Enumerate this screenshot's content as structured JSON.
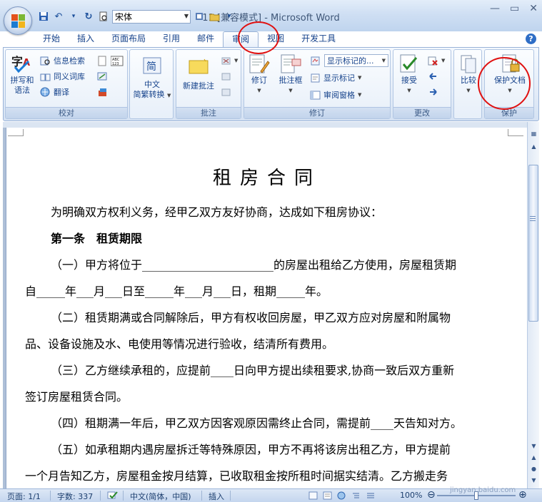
{
  "window": {
    "title": "11 [兼容模式] - Microsoft Word",
    "font_name": "宋体"
  },
  "tabs": [
    {
      "label": "开始"
    },
    {
      "label": "插入"
    },
    {
      "label": "页面布局"
    },
    {
      "label": "引用"
    },
    {
      "label": "邮件"
    },
    {
      "label": "审阅",
      "active": true
    },
    {
      "label": "视图"
    },
    {
      "label": "开发工具"
    }
  ],
  "ribbon": {
    "proofing": {
      "label": "校对",
      "spelling": "拼写和",
      "spelling2": "语法",
      "research": "信息检索",
      "thesaurus": "同义词库",
      "translate": "翻译"
    },
    "chinese": {
      "line1": "中文",
      "line2": "简繁转换"
    },
    "comments": {
      "label": "批注",
      "new_comment": "新建批注"
    },
    "tracking": {
      "label": "修订",
      "track_changes": "修订",
      "balloons": "批注框",
      "display_select": "显示标记的...",
      "show_markup": "显示标记",
      "reviewing_pane": "审阅窗格"
    },
    "changes": {
      "label": "更改",
      "accept": "接受"
    },
    "compare": {
      "compare": "比较"
    },
    "protect": {
      "label": "保护",
      "protect_document": "保护文档"
    }
  },
  "document": {
    "title": "租房合同",
    "lines": [
      "为明确双方权利义务，经甲乙双方友好协商，达成如下租房协议：",
      "第一条　租赁期限",
      "（一）甲方将位于_______________________的房屋出租给乙方使用，房屋租赁期",
      "自_____年___月___日至_____年___月___日，租期_____年。",
      "（二）租赁期满或合同解除后，甲方有权收回房屋，甲乙双方应对房屋和附属物",
      "品、设备设施及水、电使用等情况进行验收，结清所有费用。",
      "（三）乙方继续承租的，应提前____日向甲方提出续租要求,协商一致后双方重新",
      "签订房屋租赁合同。",
      "（四）租期满一年后，甲乙双方因客观原因需终止合同，需提前____天告知对方。",
      "（五）如承租期内遇房屋拆迁等特殊原因，甲方不再将该房出租乙方，甲方提前",
      "一个月告知乙方，房屋租金按月结算，已收取租金按所租时间据实结清。乙方搬走务"
    ]
  },
  "statusbar": {
    "page": "页面: 1/1",
    "words": "字数: 337",
    "language": "中文(简体，中国)",
    "insert": "插入",
    "zoom": "100%",
    "watermark": "jingyan.baidu.com"
  },
  "colors": {
    "accent": "#15428b",
    "highlight_circle": "#e01010"
  }
}
